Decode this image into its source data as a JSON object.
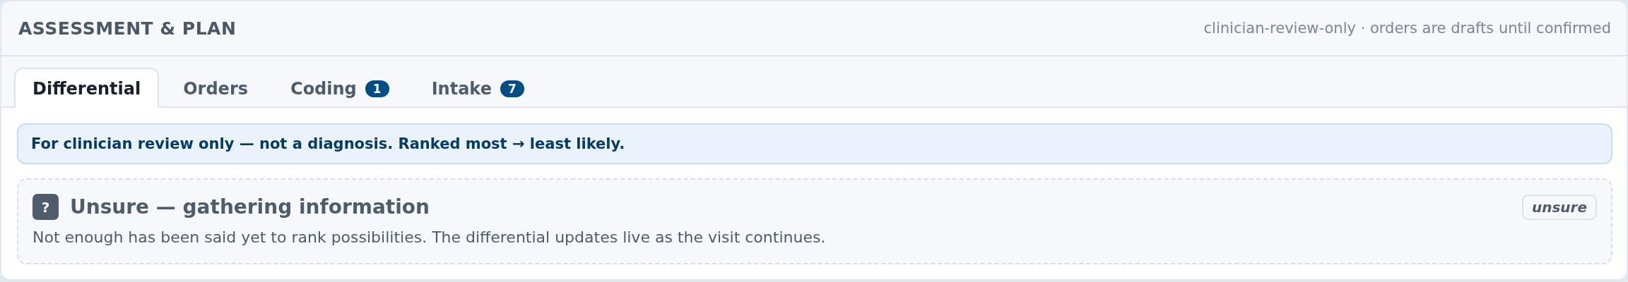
{
  "header": {
    "title": "ASSESSMENT & PLAN",
    "note": "clinician-review-only · orders are drafts until confirmed"
  },
  "tabs": [
    {
      "label": "Differential",
      "selected": true
    },
    {
      "label": "Orders",
      "selected": false
    },
    {
      "label": "Coding",
      "selected": false,
      "count": "1"
    },
    {
      "label": "Intake",
      "selected": false,
      "count": "7"
    }
  ],
  "banner": "For clinician review only — not a diagnosis. Ranked most → least likely.",
  "status_card": {
    "icon": "?",
    "title": "Unsure — gathering information",
    "tag": "unsure",
    "description": "Not enough has been said yet to rank possibilities. The differential updates live as the visit continues."
  }
}
